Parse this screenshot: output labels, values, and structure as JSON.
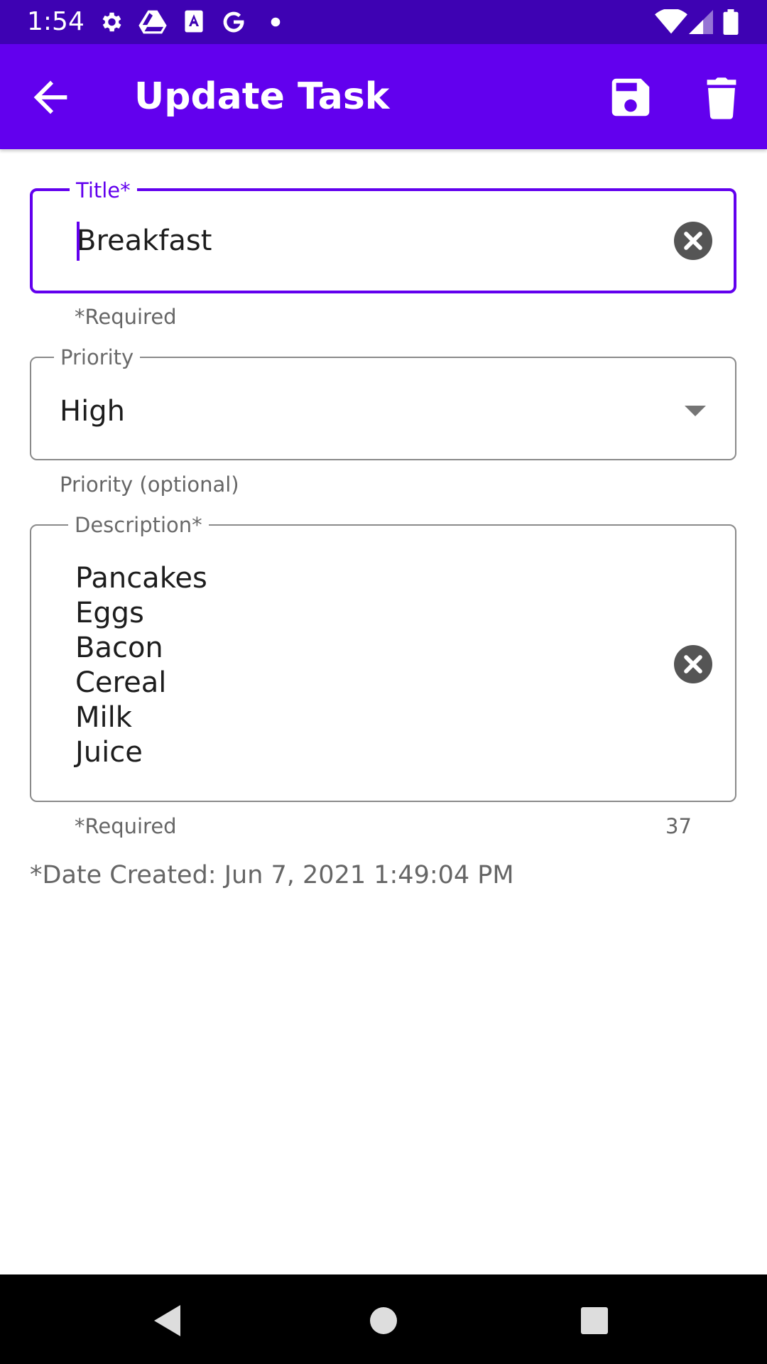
{
  "status_bar": {
    "time": "1:54",
    "left_icons": [
      "gear-icon",
      "drive-icon",
      "font-app-icon",
      "google-icon",
      "dot-icon"
    ],
    "right_icons": [
      "wifi-icon",
      "signal-icon",
      "battery-icon"
    ]
  },
  "app_bar": {
    "title": "Update Task",
    "back_icon": "arrow-back-icon",
    "actions": [
      "save-icon",
      "delete-icon"
    ]
  },
  "form": {
    "title_field": {
      "label": "Title*",
      "value": "Breakfast",
      "helper": "*Required",
      "focused": true
    },
    "priority_field": {
      "label": "Priority",
      "value": "High",
      "helper": "Priority (optional)"
    },
    "description_field": {
      "label": "Description*",
      "lines": [
        "Pancakes",
        "Eggs",
        "Bacon",
        "Cereal",
        "Milk",
        "Juice"
      ],
      "helper": "*Required",
      "counter": "37"
    },
    "date_created": "*Date Created: Jun 7, 2021 1:49:04 PM"
  },
  "colors": {
    "primary": "#6200ee",
    "primary_dark": "#3e02b3",
    "outline": "#8a8a8a"
  }
}
